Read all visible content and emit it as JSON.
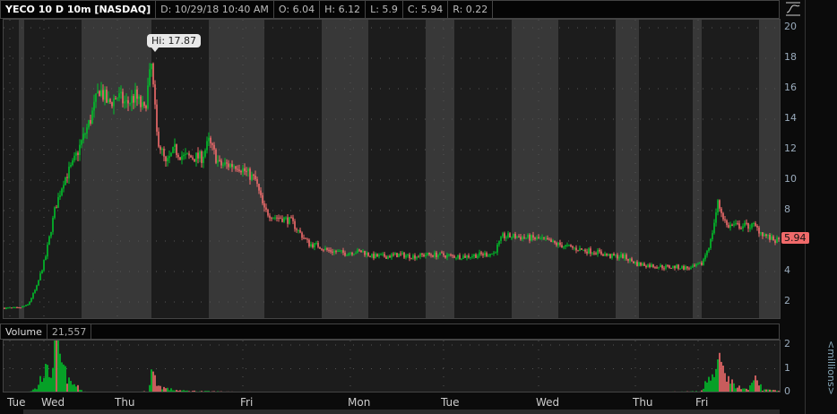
{
  "header": {
    "symbol": "YECO 10 D 10m [NASDAQ]",
    "date": "D: 10/29/18 10:40 AM",
    "open": "O: 6.04",
    "high": "H: 6.12",
    "low": "L: 5.9",
    "close": "C: 5.94",
    "range": "R: 0.22"
  },
  "hi_label": "Hi: 17.87",
  "last_price": "5.94",
  "volume_header": {
    "label": "Volume",
    "value": "21,557"
  },
  "volume_units": "<millions>",
  "colors": {
    "up": "#00c02a",
    "down": "#f26d6d",
    "bg": "#1c1c1c",
    "ext": "#383838"
  },
  "chart_data": {
    "type": "candlestick",
    "title": "YECO 10 D 10m [NASDAQ]",
    "y_ticks": [
      "20",
      "18",
      "16",
      "14",
      "12",
      "10",
      "8",
      "6",
      "4",
      "2"
    ],
    "ylim": [
      1,
      20.5
    ],
    "vol_ticks": [
      "2",
      "1",
      "0"
    ],
    "vol_ylim": [
      0,
      2.2
    ],
    "x_labels": [
      {
        "label": "Tue",
        "bar": 3
      },
      {
        "label": "Wed",
        "bar": 22
      },
      {
        "label": "Thu",
        "bar": 63
      },
      {
        "label": "Fri",
        "bar": 133
      },
      {
        "label": "Mon",
        "bar": 193
      },
      {
        "label": "Tue",
        "bar": 245
      },
      {
        "label": "Wed",
        "bar": 298
      },
      {
        "label": "Thu",
        "bar": 352
      },
      {
        "label": "Fri",
        "bar": 387
      }
    ],
    "extended_hours_bars": [
      [
        8,
        11
      ],
      [
        43,
        82
      ],
      [
        114,
        145
      ],
      [
        177,
        203
      ],
      [
        235,
        251
      ],
      [
        283,
        309
      ],
      [
        341,
        354
      ],
      [
        384,
        389
      ],
      [
        421,
        433
      ]
    ],
    "bars_total": 433,
    "price_path": [
      [
        0,
        1.6
      ],
      [
        8,
        1.6
      ],
      [
        13,
        1.8
      ],
      [
        18,
        3
      ],
      [
        23,
        5
      ],
      [
        28,
        8
      ],
      [
        33,
        10
      ],
      [
        38,
        11
      ],
      [
        43,
        12.5
      ],
      [
        48,
        14
      ],
      [
        53,
        16
      ],
      [
        58,
        15
      ],
      [
        63,
        15.5
      ],
      [
        68,
        15
      ],
      [
        73,
        15.5
      ],
      [
        78,
        14.5
      ],
      [
        82,
        17.5
      ],
      [
        85,
        13
      ],
      [
        90,
        11
      ],
      [
        95,
        12
      ],
      [
        100,
        11.5
      ],
      [
        105,
        11.5
      ],
      [
        110,
        11.5
      ],
      [
        114,
        12.5
      ],
      [
        120,
        11
      ],
      [
        125,
        11
      ],
      [
        130,
        11
      ],
      [
        135,
        10.5
      ],
      [
        140,
        10
      ],
      [
        145,
        8
      ],
      [
        150,
        7.6
      ],
      [
        155,
        7.5
      ],
      [
        160,
        7.3
      ],
      [
        165,
        6.5
      ],
      [
        170,
        5.8
      ],
      [
        175,
        5.7
      ],
      [
        180,
        5.4
      ],
      [
        185,
        5.3
      ],
      [
        190,
        5.2
      ],
      [
        195,
        5.3
      ],
      [
        200,
        5.3
      ],
      [
        205,
        5
      ],
      [
        213,
        5
      ],
      [
        220,
        5.1
      ],
      [
        228,
        5
      ],
      [
        235,
        5.1
      ],
      [
        243,
        5.1
      ],
      [
        250,
        5
      ],
      [
        258,
        5
      ],
      [
        265,
        5.1
      ],
      [
        273,
        5.2
      ],
      [
        278,
        6.3
      ],
      [
        285,
        6.3
      ],
      [
        293,
        6.2
      ],
      [
        300,
        6.1
      ],
      [
        308,
        5.8
      ],
      [
        315,
        5.6
      ],
      [
        323,
        5.4
      ],
      [
        330,
        5.3
      ],
      [
        338,
        5
      ],
      [
        345,
        5
      ],
      [
        353,
        4.5
      ],
      [
        360,
        4.4
      ],
      [
        368,
        4.3
      ],
      [
        375,
        4.3
      ],
      [
        383,
        4.2
      ],
      [
        389,
        4.5
      ],
      [
        394,
        6
      ],
      [
        398,
        8.5
      ],
      [
        403,
        7
      ],
      [
        408,
        7
      ],
      [
        413,
        7
      ],
      [
        418,
        7
      ],
      [
        423,
        6.5
      ],
      [
        428,
        6.1
      ],
      [
        433,
        5.94
      ]
    ],
    "high": 17.87,
    "last": 5.94,
    "volume_path": [
      [
        0,
        0
      ],
      [
        14,
        0.05
      ],
      [
        18,
        0.2
      ],
      [
        22,
        1
      ],
      [
        26,
        0.9
      ],
      [
        28,
        2.1
      ],
      [
        30,
        1.8
      ],
      [
        33,
        1.1
      ],
      [
        36,
        0.5
      ],
      [
        40,
        0.3
      ],
      [
        44,
        0.05
      ],
      [
        60,
        0
      ],
      [
        80,
        0.05
      ],
      [
        82,
        1.0
      ],
      [
        86,
        0.3
      ],
      [
        92,
        0.15
      ],
      [
        100,
        0.08
      ],
      [
        115,
        0.05
      ],
      [
        140,
        0.03
      ],
      [
        200,
        0.02
      ],
      [
        280,
        0.03
      ],
      [
        360,
        0.02
      ],
      [
        388,
        0.05
      ],
      [
        395,
        0.9
      ],
      [
        399,
        1.3
      ],
      [
        402,
        0.8
      ],
      [
        408,
        0.3
      ],
      [
        415,
        0.1
      ],
      [
        419,
        0.7
      ],
      [
        423,
        0.15
      ],
      [
        433,
        0.05
      ]
    ]
  }
}
